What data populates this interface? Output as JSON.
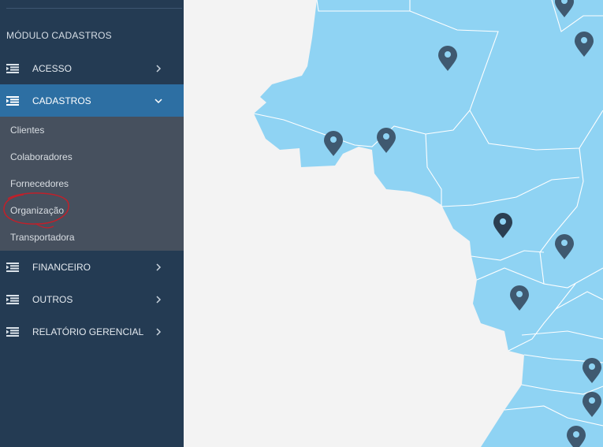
{
  "sidebar": {
    "module_title": "MÓDULO CADASTROS",
    "menu": [
      {
        "label": "ACESSO"
      },
      {
        "label": "CADASTROS"
      },
      {
        "label": "FINANCEIRO"
      },
      {
        "label": "OUTROS"
      },
      {
        "label": "RELATÓRIO GERENCIAL"
      }
    ],
    "submenu": [
      {
        "label": "Clientes"
      },
      {
        "label": "Colaboradores"
      },
      {
        "label": "Fornecedores"
      },
      {
        "label": "Organização"
      },
      {
        "label": "Transportadora"
      }
    ]
  },
  "colors": {
    "sidebar_bg": "#243b53",
    "active_bg": "#2d6fa3",
    "submenu_bg": "#46505e",
    "map_land": "#8fd3f3",
    "map_bg": "#f3f3f3",
    "pin": "#3f5970",
    "annotation": "#c0202a"
  },
  "icons": {
    "menu_icon": "list-indent-icon",
    "chevron_right": "chevron-right-icon",
    "chevron_down": "chevron-down-icon",
    "map_pin": "map-pin-icon"
  }
}
